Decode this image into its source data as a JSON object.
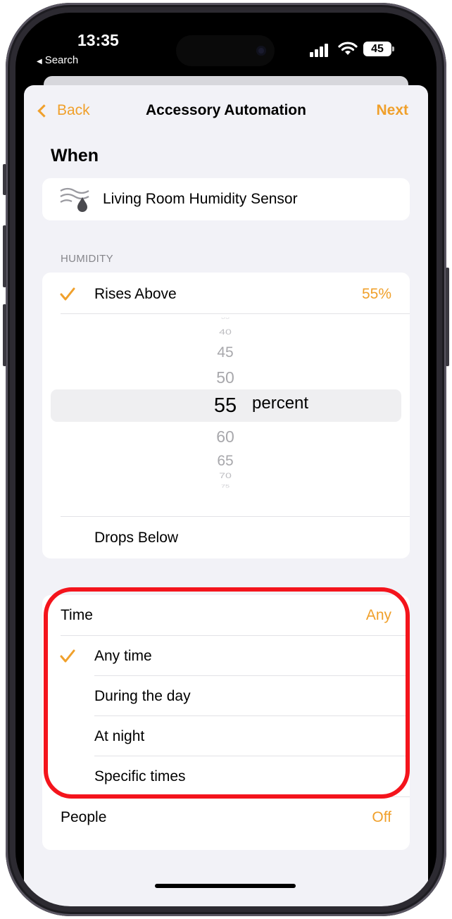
{
  "status_bar": {
    "time": "13:35",
    "back_label": "Search",
    "battery": "45"
  },
  "nav": {
    "back_label": "Back",
    "title": "Accessory Automation",
    "next_label": "Next"
  },
  "when": {
    "title": "When",
    "accessory_name": "Living Room Humidity Sensor",
    "accessory_icon": "humidity-sensor-icon"
  },
  "humidity": {
    "header": "HUMIDITY",
    "rises_above_label": "Rises Above",
    "rises_above_value": "55%",
    "picker_values": [
      "35",
      "40",
      "45",
      "50",
      "55",
      "60",
      "65",
      "70",
      "75"
    ],
    "picker_selected": "55",
    "picker_unit": "percent",
    "drops_below_label": "Drops Below"
  },
  "time": {
    "label": "Time",
    "value": "Any",
    "options": [
      "Any time",
      "During the day",
      "At night",
      "Specific times"
    ],
    "selected_option": "Any time"
  },
  "people": {
    "label": "People",
    "value": "Off"
  },
  "colors": {
    "accent": "#f0a02b",
    "highlight": "#f4141c",
    "background": "#f2f2f7"
  }
}
